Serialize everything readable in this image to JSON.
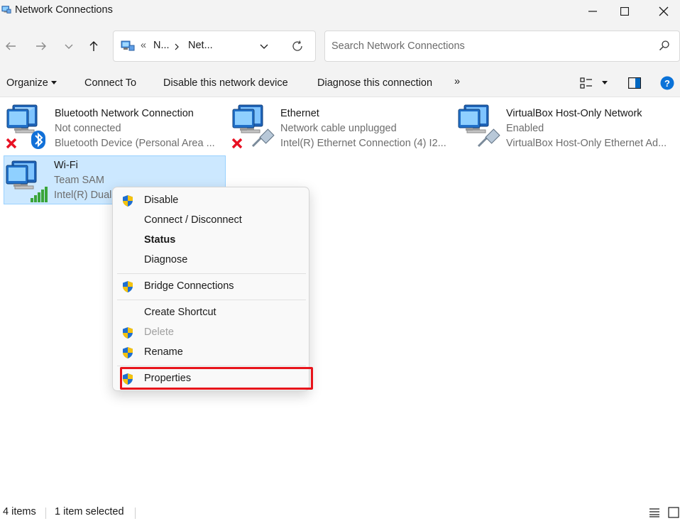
{
  "window": {
    "title": "Network Connections"
  },
  "address": {
    "overflow": "«",
    "crumbs": [
      "N...",
      "Net..."
    ],
    "search_placeholder": "Search Network Connections"
  },
  "commands": {
    "organize": "Organize",
    "connect_to": "Connect To",
    "disable": "Disable this network device",
    "diagnose": "Diagnose this connection",
    "more": "»"
  },
  "connections": [
    {
      "name": "Bluetooth Network Connection",
      "status": "Not connected",
      "device": "Bluetooth Device (Personal Area ...",
      "icon": "bluetooth-network-icon",
      "badge": "red-x"
    },
    {
      "name": "Ethernet",
      "status": "Network cable unplugged",
      "device": "Intel(R) Ethernet Connection (4) I2...",
      "icon": "ethernet-network-icon",
      "badge": "red-x"
    },
    {
      "name": "VirtualBox Host-Only Network",
      "status": "Enabled",
      "device": "VirtualBox Host-Only Ethernet Ad...",
      "icon": "ethernet-network-icon",
      "badge": "none"
    },
    {
      "name": "Wi-Fi",
      "status": "Team SAM",
      "device": "Intel(R) Dual",
      "icon": "wifi-network-icon",
      "badge": "signal-bars",
      "selected": true
    }
  ],
  "context_menu": {
    "items": [
      {
        "label": "Disable",
        "shield": true
      },
      {
        "label": "Connect / Disconnect",
        "shield": false
      },
      {
        "label": "Status",
        "shield": false,
        "bold": true
      },
      {
        "label": "Diagnose",
        "shield": false
      },
      {
        "label": "Bridge Connections",
        "shield": true
      },
      {
        "label": "Create Shortcut",
        "shield": false
      },
      {
        "label": "Delete",
        "shield": true,
        "disabled": true
      },
      {
        "label": "Rename",
        "shield": true
      },
      {
        "label": "Properties",
        "shield": true,
        "highlighted": true
      }
    ]
  },
  "status_bar": {
    "item_count": "4 items",
    "selection": "1 item selected"
  },
  "colors": {
    "accent": "#0067c0",
    "selection_bg": "#cce8ff",
    "highlight_box": "#e8141b",
    "chrome_bg": "#f3f3f3"
  }
}
